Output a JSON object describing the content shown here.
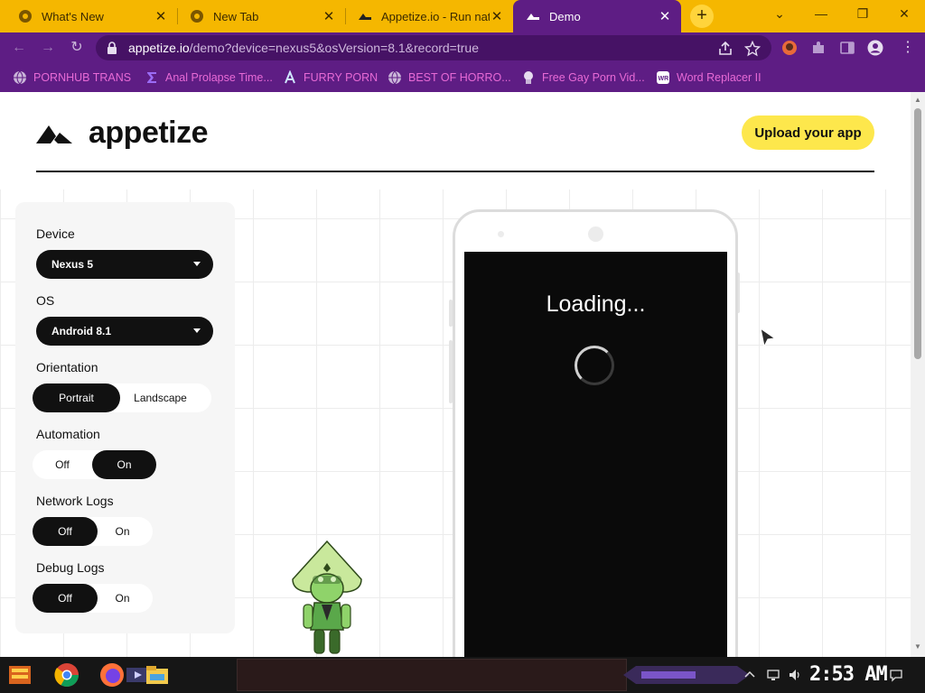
{
  "browser": {
    "tabs": [
      {
        "title": "What's New",
        "icon": "chrome-icon",
        "active": false
      },
      {
        "title": "New Tab",
        "icon": "chrome-icon",
        "active": false
      },
      {
        "title": "Appetize.io - Run nat",
        "icon": "appetize-icon",
        "active": false
      },
      {
        "title": "Demo",
        "icon": "appetize-icon",
        "active": true
      }
    ],
    "new_tab": "+",
    "window_controls": {
      "menu": "⌄",
      "minimize": "—",
      "restore": "❐",
      "close": "✕"
    },
    "url_host": "appetize.io",
    "url_rest": "/demo?device=nexus5&osVersion=8.1&record=true",
    "bookmarks": [
      {
        "label": "PORNHUB TRANS",
        "icon": "globe-icon"
      },
      {
        "label": "Anal Prolapse Time...",
        "icon": "sigma-icon"
      },
      {
        "label": "FURRY PORN",
        "icon": "lambda-icon"
      },
      {
        "label": "BEST OF HORRO...",
        "icon": "globe-icon"
      },
      {
        "label": "Free Gay Porn Vid...",
        "icon": "mascot-icon"
      },
      {
        "label": "Word Replacer II",
        "icon": "wr-icon"
      }
    ],
    "colors": {
      "tabstrip": "#f5b700",
      "toolbar": "#5e1d84",
      "bookmark_text": "#e86ad6"
    }
  },
  "page": {
    "logo_text": "appetize",
    "upload_button": "Upload your app",
    "settings": {
      "device_label": "Device",
      "device_value": "Nexus 5",
      "os_label": "OS",
      "os_value": "Android 8.1",
      "orientation_label": "Orientation",
      "orientation_options": [
        "Portrait",
        "Landscape"
      ],
      "orientation_selected": "Portrait",
      "automation_label": "Automation",
      "automation_options": [
        "Off",
        "On"
      ],
      "automation_selected": "On",
      "network_logs_label": "Network Logs",
      "network_logs_options": [
        "Off",
        "On"
      ],
      "network_logs_selected": "Off",
      "debug_logs_label": "Debug Logs",
      "debug_logs_options": [
        "Off",
        "On"
      ],
      "debug_logs_selected": "Off"
    },
    "device_screen": {
      "loading_text": "Loading..."
    },
    "colors": {
      "upload_button": "#fde74c",
      "select_bg": "#111111"
    }
  },
  "taskbar": {
    "apps": [
      "start-icon",
      "chrome-icon",
      "firefox-icon",
      "media-icon",
      "file-explorer-icon"
    ],
    "clock": "2:53 AM"
  }
}
